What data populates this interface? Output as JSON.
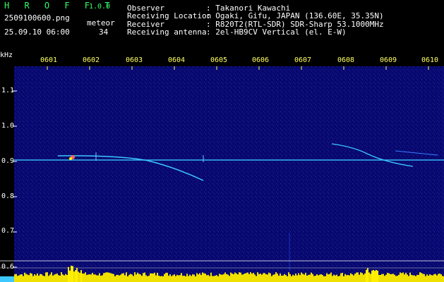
{
  "header": {
    "brand": "H R O F F T",
    "version": "1.0.0",
    "filename": "2509100600.png",
    "timestamp": "25.09.10 06:00",
    "meteor_label": "meteor",
    "meteor_count": "34"
  },
  "info": [
    {
      "key": "Observer",
      "value": ": Takanori Kawachi"
    },
    {
      "key": "Receiving Location",
      "value": ": Ogaki, Gifu, JAPAN (136.60E, 35.35N)"
    },
    {
      "key": "Receiver",
      "value": ": R820T2(RTL-SDR) SDR-Sharp 53.1000MHz"
    },
    {
      "key": "Receiving antenna",
      "value": ": 2el-HB9CV Vertical (el. E-W)"
    }
  ],
  "axis": {
    "y_unit": "kHz",
    "y_ticks": [
      "1.1",
      "1.0",
      "0.9",
      "0.8",
      "0.7",
      "0.6"
    ],
    "x_ticks": [
      "0601",
      "0602",
      "0603",
      "0604",
      "0605",
      "0606",
      "0607",
      "0608",
      "0609",
      "0610"
    ]
  },
  "colors": {
    "background": "#000000",
    "spectrogram": "#0a0a7a",
    "carrier": "#3cc8ff",
    "brand": "#33ff66",
    "tick_text": "#ffff66",
    "trace_hot": "#ffff00"
  }
}
